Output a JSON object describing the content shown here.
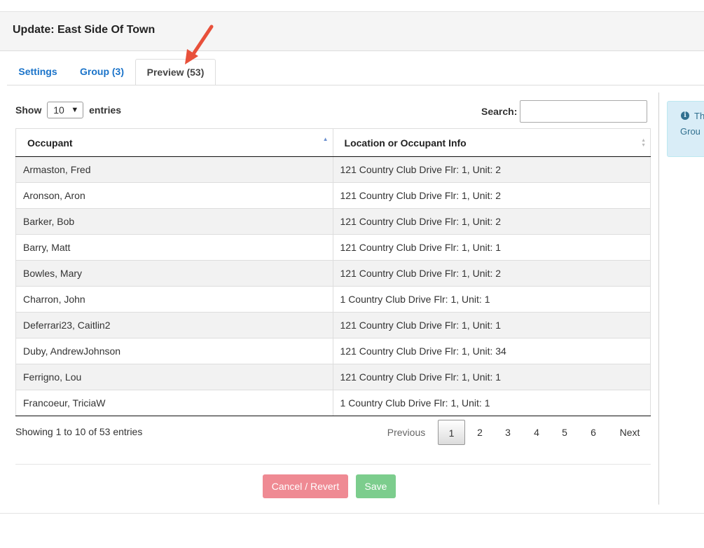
{
  "header": {
    "title": "Update: East Side Of Town"
  },
  "tabs": [
    {
      "label": "Settings"
    },
    {
      "label": "Group (3)"
    },
    {
      "label": "Preview (53)"
    }
  ],
  "length_menu": {
    "show_label": "Show",
    "value": "10",
    "entries_label": "entries"
  },
  "search": {
    "label": "Search:",
    "value": ""
  },
  "table": {
    "columns": [
      "Occupant",
      "Location or Occupant Info"
    ],
    "rows": [
      [
        "Armaston, Fred",
        "121 Country Club Drive Flr: 1, Unit: 2"
      ],
      [
        "Aronson, Aron",
        "121 Country Club Drive Flr: 1, Unit: 2"
      ],
      [
        "Barker, Bob",
        "121 Country Club Drive Flr: 1, Unit: 2"
      ],
      [
        "Barry, Matt",
        "121 Country Club Drive Flr: 1, Unit: 1"
      ],
      [
        "Bowles, Mary",
        "121 Country Club Drive Flr: 1, Unit: 2"
      ],
      [
        "Charron, John",
        "1 Country Club Drive Flr: 1, Unit: 1"
      ],
      [
        "Deferrari23, Caitlin2",
        "121 Country Club Drive Flr: 1, Unit: 1"
      ],
      [
        "Duby, AndrewJohnson",
        "121 Country Club Drive Flr: 1, Unit: 34"
      ],
      [
        "Ferrigno, Lou",
        "121 Country Club Drive Flr: 1, Unit: 1"
      ],
      [
        "Francoeur, TriciaW",
        "1 Country Club Drive Flr: 1, Unit: 1"
      ]
    ]
  },
  "table_info": "Showing 1 to 10 of 53 entries",
  "pagination": {
    "previous": "Previous",
    "pages": [
      "1",
      "2",
      "3",
      "4",
      "5",
      "6"
    ],
    "current": "1",
    "next": "Next"
  },
  "buttons": {
    "cancel": "Cancel / Revert",
    "save": "Save"
  },
  "info_panel": {
    "line1": "Th",
    "line2": "Grou"
  },
  "colors": {
    "link": "#1a73c9",
    "cancel": "#ef8a93",
    "save": "#7ccd8d",
    "info_bg": "#d9edf7",
    "arrow": "#e8503a"
  }
}
